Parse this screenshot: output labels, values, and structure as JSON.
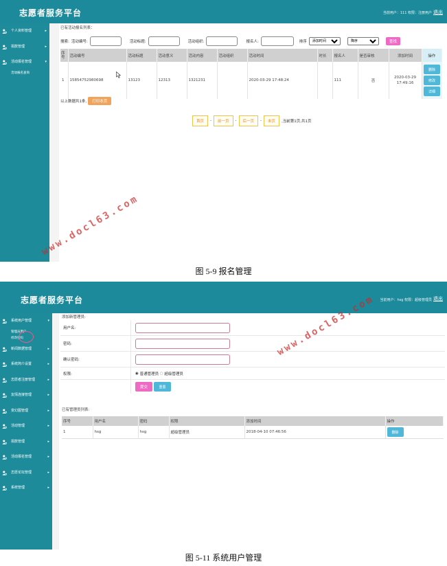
{
  "app_title": "志愿者服务平台",
  "watermark": "www.docl63.com",
  "figures": [
    {
      "caption": "图 5-9 报名管理",
      "header": {
        "user_info": "当前用户：111  权限：注册用户",
        "logout": "退出"
      },
      "sidebar": [
        {
          "label": "个人资料管理",
          "icon": "user-icon"
        },
        {
          "label": "捐款管理",
          "icon": "user-icon"
        },
        {
          "label": "活动报名管理",
          "icon": "user-icon",
          "sub": [
            "活动报名查询"
          ]
        }
      ],
      "list_title": "已有活动报名列表：",
      "search": {
        "lead": "搜索:",
        "fields": [
          "活动编号:",
          "活动标题:",
          "活动组织:",
          "报名人:"
        ],
        "sort_label": "排序",
        "sort_field": "添加时间",
        "sort_order": "降序",
        "button": "查找"
      },
      "table": {
        "columns": [
          "序号",
          "活动编号",
          "活动标题",
          "活动意义",
          "活动内容",
          "活动组织",
          "活动时间",
          "时长",
          "报名人",
          "是否审核",
          "添加时间",
          "操作"
        ],
        "rows": [
          {
            "no": "1",
            "code": "15854752980698",
            "title": "13123",
            "meaning": "12313",
            "content": "1321231",
            "org": "",
            "time": "2020-03-29 17:48:24",
            "duration": "",
            "applicant": "111",
            "audited": "否",
            "added_date": "2020-03-29",
            "added_time": "17:49:16",
            "actions": [
              "删除",
              "修改",
              "详细"
            ]
          }
        ]
      },
      "count_text": "以上数据共1条,",
      "print_button": "打印本页",
      "pager": {
        "first": "首页",
        "prev": "前一页",
        "next": "后一页",
        "last": "末页",
        "info": ",当前第1页,共1页"
      }
    },
    {
      "caption": "图 5-11 系统用户管理",
      "header": {
        "user_info": "当前用户：hsg  权限：超级管理员",
        "logout": "退出"
      },
      "sidebar": [
        {
          "label": "系统用户管理",
          "icon": "user-icon",
          "sub": [
            "管理员用户",
            "修改密码"
          ]
        },
        {
          "label": "新闻数据管理",
          "icon": "user-icon"
        },
        {
          "label": "系统简介设置",
          "icon": "user-icon"
        },
        {
          "label": "志愿者注册管理",
          "icon": "user-icon"
        },
        {
          "label": "友情连接管理",
          "icon": "user-icon"
        },
        {
          "label": "变幻图管理",
          "icon": "user-icon"
        },
        {
          "label": "活动管理",
          "icon": "user-icon"
        },
        {
          "label": "捐款管理",
          "icon": "user-icon"
        },
        {
          "label": "活动报名管理",
          "icon": "user-icon"
        },
        {
          "label": "志愿论坛管理",
          "icon": "user-icon"
        },
        {
          "label": "系统管理",
          "icon": "user-icon"
        }
      ],
      "form_title": "添加新管理员:",
      "form": {
        "username": "用户名:",
        "password": "密码:",
        "confirm": "确认密码:",
        "role": "权限:",
        "role_options": [
          "普通管理员",
          "超级管理员"
        ],
        "role_selected": "普通管理员",
        "submit": "提交",
        "reset": "重置"
      },
      "list_title": "已有管理员列表:",
      "table": {
        "columns": [
          "序号",
          "用户名",
          "密码",
          "权限",
          "添加时间",
          "操作"
        ],
        "rows": [
          {
            "no": "1",
            "user": "hsg",
            "password": "hsg",
            "role": "超级管理员",
            "added": "2018-04-10 07:46:56",
            "action": "删除"
          }
        ]
      }
    }
  ]
}
